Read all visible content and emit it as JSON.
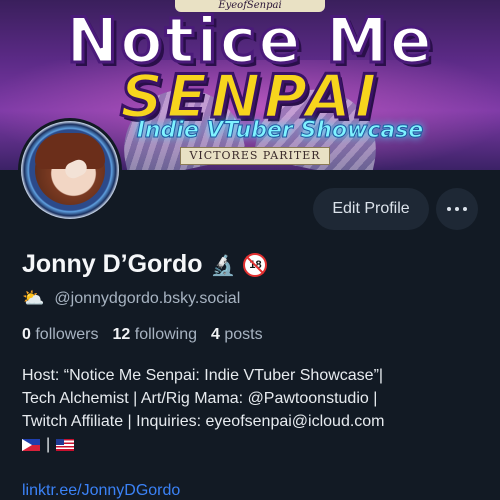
{
  "banner": {
    "top_text": "EyeofSenpai",
    "title_line1": "Notice Me",
    "title_line2": "SENPAI",
    "subtitle": "Indie VTuber Showcase",
    "ribbon": "VICTORES PARITER"
  },
  "profile": {
    "avatar_icon": "avatar-image",
    "name": "Jonny D’Gordo",
    "name_emojis": [
      "microscope-icon",
      "no-under-18-icon"
    ],
    "microscope_glyph": "🔬",
    "age_badge": "18",
    "handle_emoji": "sun-behind-cloud-icon",
    "handle_glyph": "⛅",
    "handle": "@jonnydgordo.bsky.social"
  },
  "actions": {
    "edit_label": "Edit Profile",
    "more_icon": "more-horizontal-icon"
  },
  "stats": {
    "followers_count": "0",
    "followers_label": "followers",
    "following_count": "12",
    "following_label": "following",
    "posts_count": "4",
    "posts_label": "posts"
  },
  "bio": {
    "line1": "Host: “Notice Me Senpai: Indie VTuber Showcase”|",
    "line2": "Tech Alchemist | Art/Rig Mama: @Pawtoonstudio |",
    "line3": "Twitch Affiliate | Inquiries: eyeofsenpai@icloud.com",
    "flags": [
      "philippines-flag-icon",
      "usa-flag-icon"
    ],
    "flag_separator": "|"
  },
  "link": {
    "text": "linktr.ee/JonnyDGordo"
  },
  "colors": {
    "background": "#121a24",
    "accent_link": "#3b82f6",
    "button_bg": "#1e2835",
    "muted_text": "#a7b3c1"
  }
}
